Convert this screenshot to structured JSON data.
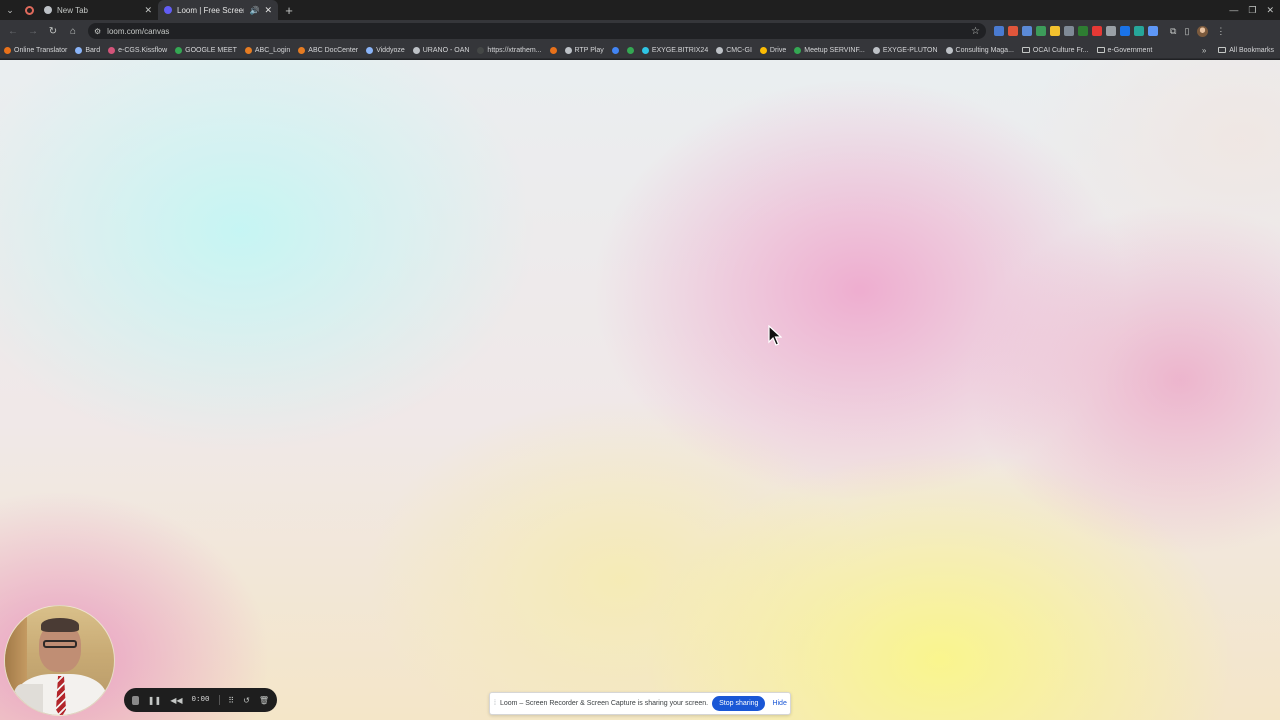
{
  "tabs": [
    {
      "title": "New Tab",
      "favicon_color": "#bdc1c6",
      "active": false
    },
    {
      "title": "Loom | Free Screen & Vi",
      "favicon_color": "#625df5",
      "active": true
    }
  ],
  "address": {
    "url": "loom.com/canvas"
  },
  "extension_colors": [
    "#4a7bd1",
    "#e0563b",
    "#5b8ad6",
    "#3d9c5a",
    "#f2c12e",
    "#7f8a96",
    "#2e7d32",
    "#e53935",
    "#9aa0a6",
    "#1a73e8",
    "#26a69a",
    "#5e97f6"
  ],
  "bookmarks": [
    {
      "label": "Online Translator",
      "color": "#e8711a"
    },
    {
      "label": "Bard",
      "color": "#8ab4f8"
    },
    {
      "label": "e-CGS.Kissflow",
      "color": "#d4547a"
    },
    {
      "label": "GOOGLE MEET",
      "color": "#34a853"
    },
    {
      "label": "ABC_Login",
      "color": "#e67c22"
    },
    {
      "label": "ABC DocCenter",
      "color": "#e67c22"
    },
    {
      "label": "Viddyoze",
      "color": "#8ab4f8"
    },
    {
      "label": "URANO - OAN",
      "color": "#bdc1c6"
    },
    {
      "label": "https://xtrathem...",
      "color": "#444746"
    },
    {
      "label": "",
      "color": "#e8711a"
    },
    {
      "label": "RTP Play",
      "color": "#bdc1c6"
    },
    {
      "label": "",
      "color": "#4285f4"
    },
    {
      "label": "",
      "color": "#34a853"
    },
    {
      "label": "EXYGE.BITRIX24",
      "color": "#2ec5e5"
    },
    {
      "label": "CMC-GI",
      "color": "#bdc1c6"
    },
    {
      "label": "Drive",
      "color": "#fbbc04"
    },
    {
      "label": "Meetup SERVINF...",
      "color": "#34a853"
    },
    {
      "label": "EXYGE-PLUTON",
      "color": "#bdc1c6"
    },
    {
      "label": "Consulting Maga...",
      "color": "#bdc1c6"
    },
    {
      "label": "OCAI Culture Fr...",
      "color": "folder"
    },
    {
      "label": "e-Government",
      "color": "folder"
    }
  ],
  "all_bookmarks": "All Bookmarks",
  "recorder": {
    "time": "0:00"
  },
  "share_banner": {
    "text": "Loom – Screen Recorder & Screen Capture is sharing your screen.",
    "stop_label": "Stop sharing",
    "hide_label": "Hide"
  },
  "colors": {
    "accent": "#1a57d6",
    "tab_active": "#35363a",
    "frame": "#1f1f1f"
  }
}
